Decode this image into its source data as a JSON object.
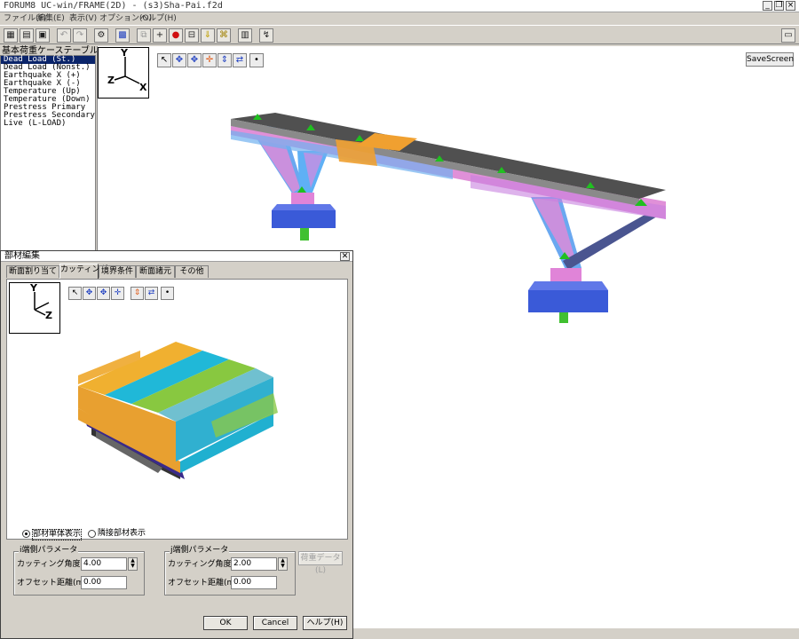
{
  "window": {
    "title": "FORUM8 UC-win/FRAME(2D) - (s3)Sha-Pai.f2d"
  },
  "menu": {
    "items": [
      "ファイル(F)",
      "編集(E)",
      "表示(V)",
      "オプション(O)",
      "ヘルプ(H)"
    ]
  },
  "case_table": {
    "label": "基本荷重ケーステーブル",
    "items": [
      "Dead Load (St.)",
      "Dead Load (Nonst.)",
      "Earthquake X (+)",
      "Earthquake X (-)",
      "Temperature (Up)",
      "Temperature (Down)",
      "Prestress Primary",
      "Prestress Secondary",
      "Live (L-LOAD)"
    ],
    "selected": 0
  },
  "viewport": {
    "save_screen": "SaveScreen",
    "axis_y": "Y",
    "axis_x": "X",
    "axis_z": "Z"
  },
  "dialog": {
    "title": "部材編集",
    "close": "✕",
    "tabs": [
      "断面割り当て",
      "カッティング",
      "境界条件",
      "断面諸元",
      "その他"
    ],
    "active_tab": 1,
    "display_options": [
      "部材単体表示",
      "隣接部材表示"
    ],
    "selected_option": 0,
    "i_end": {
      "label": "i端側パラメータ",
      "angle_label": "カッティング角度(deg)",
      "angle_value": "4.00",
      "offset_label": "オフセット距離(m)",
      "offset_value": "0.00"
    },
    "j_end": {
      "label": "j端側パラメータ",
      "angle_label": "カッティング角度(deg)",
      "angle_value": "2.00",
      "offset_label": "オフセット距離(m)",
      "offset_value": "0.00"
    },
    "load_data_button": "荷重データ(L)",
    "ok": "OK",
    "cancel": "Cancel",
    "help": "ヘルプ(H)",
    "axis_y": "Y",
    "axis_z": "Z"
  },
  "colors": {
    "selection": "#0a246a",
    "deck": "#555555",
    "pier_pink": "#e080d0",
    "pier_blue": "#5fa8f0",
    "footing": "#3a5ad8",
    "highlight": "#f0a030",
    "support": "#20c020"
  }
}
